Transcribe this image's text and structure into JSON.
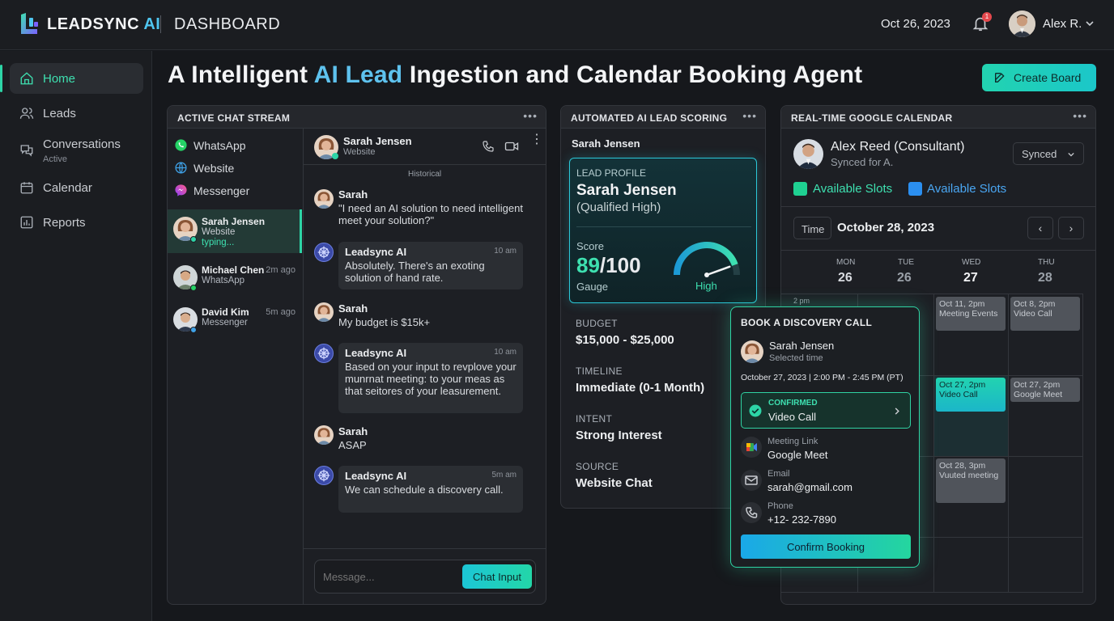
{
  "header": {
    "brand": "LEADSYNC",
    "brand_ai": "AI",
    "section": "DASHBOARD",
    "date": "Oct 26, 2023",
    "notif_count": "1",
    "user": "Alex R."
  },
  "sidebar": {
    "items": [
      {
        "label": "Home",
        "icon": "home-icon"
      },
      {
        "label": "Leads",
        "icon": "users-icon"
      },
      {
        "label": "Conversations",
        "sub": "Active",
        "icon": "chat-icon"
      },
      {
        "label": "Calendar",
        "icon": "calendar-icon"
      },
      {
        "label": "Reports",
        "icon": "chart-icon"
      }
    ]
  },
  "page": {
    "title_a": "A Intelligent ",
    "title_hl": "AI Lead",
    "title_b": " Ingestion and Calendar Booking Agent",
    "create_label": "Create Board"
  },
  "chat": {
    "title": "ACTIVE CHAT STREAM",
    "channels": [
      "WhatsApp",
      "Website",
      "Messenger"
    ],
    "conversations": [
      {
        "name": "Sarah Jensen",
        "source": "Website",
        "status": "typing...",
        "time": ""
      },
      {
        "name": "Michael Chen",
        "source": "WhatsApp",
        "time": "2m ago"
      },
      {
        "name": "David Kim",
        "source": "Messenger",
        "time": "5m ago"
      }
    ],
    "active_name": "Sarah Jensen",
    "active_source": "Website",
    "historical": "Historical",
    "messages": [
      {
        "from": "Sarah",
        "text": "\"I need an AI solution to need intelligent meet your solution?\""
      },
      {
        "from": "Leadsync AI",
        "time": "10 am",
        "text": "Absolutely. There's an exoting solution of hand rate."
      },
      {
        "from": "Sarah",
        "text": "My budget is $15k+"
      },
      {
        "from": "Leadsync AI",
        "time": "10 am",
        "text": "Based on your input to revplove your munrnat meeting: to your meas as that seitores of your leasurement."
      },
      {
        "from": "Sarah",
        "text": "ASAP"
      },
      {
        "from": "Leadsync AI",
        "time": "5m am",
        "text": "We can schedule a discovery call."
      }
    ],
    "input_placeholder": "Message...",
    "send_label": "Chat Input"
  },
  "scoring": {
    "title": "AUTOMATED AI LEAD SCORING",
    "lead": "Sarah Jensen",
    "profile_label": "LEAD PROFILE",
    "profile_name": "Sarah Jensen",
    "profile_qual": "(Qualified High)",
    "score_label": "Score",
    "score": "89",
    "score_max": "/100",
    "gauge_label": "Gauge",
    "gauge_level": "High",
    "gauge_fraction": 0.89,
    "fields": [
      {
        "label": "BUDGET",
        "value": "$15,000 - $25,000"
      },
      {
        "label": "TIMELINE",
        "value": "Immediate (0-1 Month)"
      },
      {
        "label": "INTENT",
        "value": "Strong Interest"
      },
      {
        "label": "SOURCE",
        "value": "Website Chat"
      }
    ]
  },
  "calendar": {
    "title": "REAL-TIME GOOGLE CALENDAR",
    "consultant": "Alex Reed (Consultant)",
    "synced_for": "Synced for A.",
    "sync_status": "Synced",
    "legend": [
      {
        "label": "Available Slots",
        "color": "#1fd192"
      },
      {
        "label": "Available Slots",
        "color": "#2b8ff0"
      }
    ],
    "time_btn": "Time",
    "date": "October 28, 2023",
    "days": [
      {
        "d": "MON",
        "n": "26"
      },
      {
        "d": "TUE",
        "n": "26"
      },
      {
        "d": "WED",
        "n": "27"
      },
      {
        "d": "THU",
        "n": "28"
      }
    ],
    "hour": "2 pm",
    "slots": [
      {
        "text": "Oct 11, 2pm Meeting Events"
      },
      {
        "text": "Oct 8, 2pm Video Call"
      },
      {
        "text": "Oct 27, 2pm Video Call"
      },
      {
        "text": "Oct 27, 2pm Google Meet"
      },
      {
        "text": "Oct 28, 3pm Vuuted meeting"
      }
    ]
  },
  "booking": {
    "title": "BOOK A DISCOVERY CALL",
    "name": "Sarah Jensen",
    "sub": "Selected time",
    "datetime": "October 27, 2023 | 2:00 PM - 2:45 PM (PT)",
    "confirmed_label": "CONFIRMED",
    "confirmed_value": "Video Call",
    "rows": [
      {
        "label": "Meeting Link",
        "value": "Google Meet"
      },
      {
        "label": "Email",
        "value": "sarah@gmail.com"
      },
      {
        "label": "Phone",
        "value": "+12- 232-7890"
      }
    ],
    "confirm_label": "Confirm Booking"
  }
}
